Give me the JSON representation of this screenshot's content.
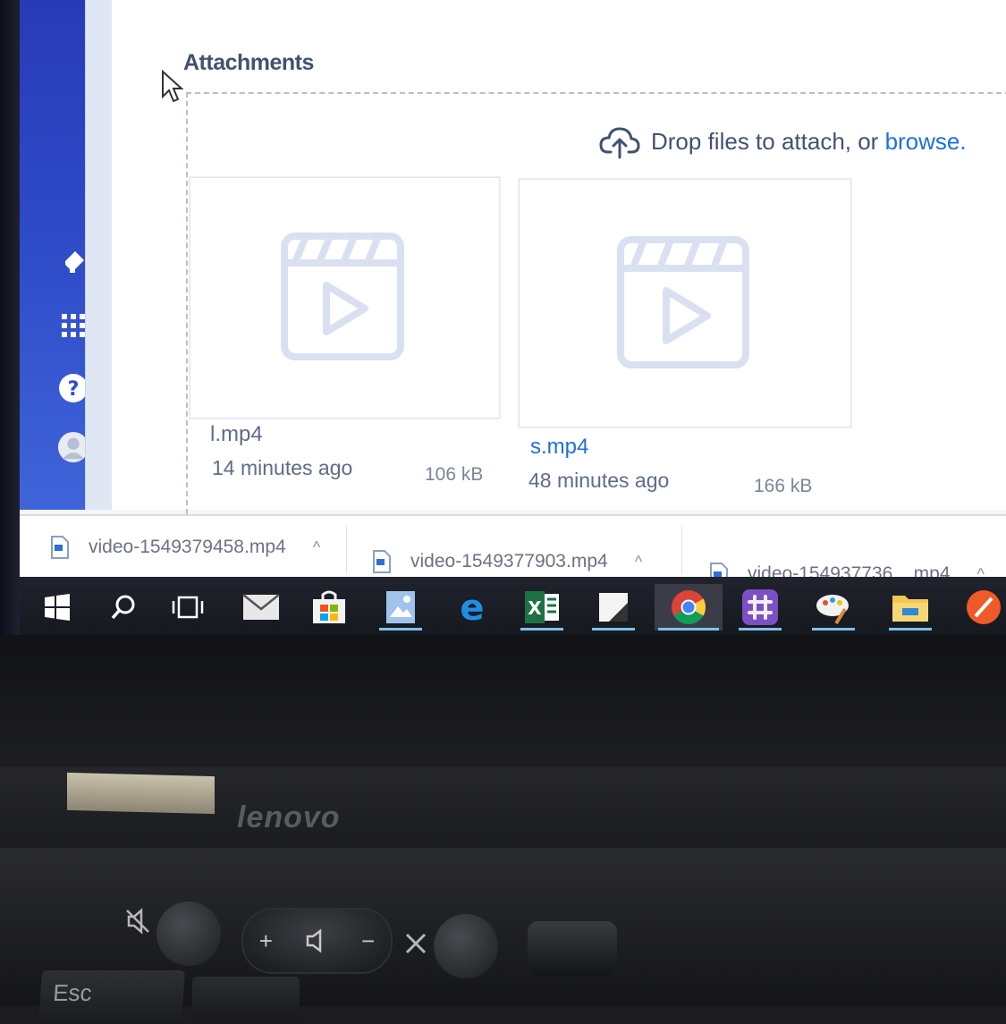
{
  "attachments": {
    "title": "Attachments",
    "drop_text": "Drop files to attach, or ",
    "browse_link": "browse."
  },
  "files": [
    {
      "name": "l.mp4",
      "time": "14 minutes ago",
      "size": "106 kB"
    },
    {
      "name": "s.mp4",
      "time": "48 minutes ago",
      "size": "166 kB"
    }
  ],
  "downloads": [
    {
      "name": "video-1549379458.mp4",
      "chevron": "^"
    },
    {
      "name": "video-1549377903.mp4",
      "chevron": "^"
    },
    {
      "name": "video-154937736....mp4",
      "chevron": "^"
    }
  ],
  "taskbar": [
    "windows-start-icon",
    "search-icon",
    "task-view-icon",
    "mail-icon",
    "store-icon",
    "photo-app-icon",
    "edge-icon",
    "excel-icon",
    "sticky-notes-icon",
    "chrome-icon",
    "slack-icon",
    "paint-icon",
    "file-explorer-icon",
    "app-icon"
  ],
  "laptop": {
    "brand": "lenovo",
    "esc_label": "Esc",
    "vol_up": "+",
    "vol_down": "−"
  },
  "colors": {
    "sidebar": "#2f4cc9",
    "link": "#1f6fe0",
    "text": "#42526e",
    "taskbar": "#1b1d24"
  }
}
